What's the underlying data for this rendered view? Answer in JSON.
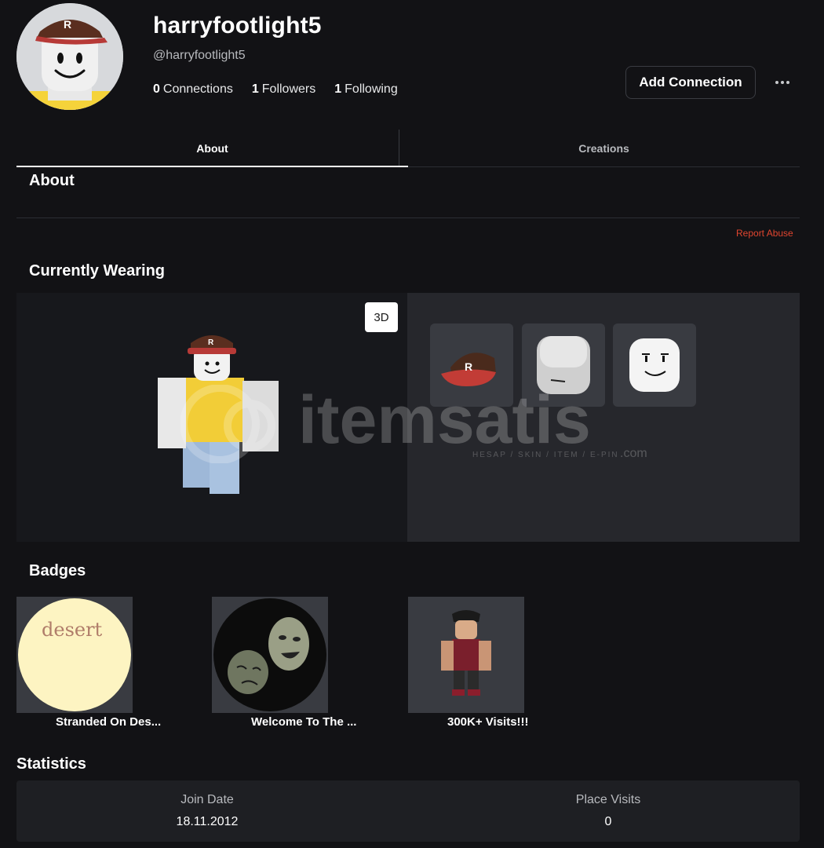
{
  "profile": {
    "display_name": "harryfootlight5",
    "handle": "@harryfootlight5",
    "connections_count": "0",
    "connections_label": "Connections",
    "followers_count": "1",
    "followers_label": "Followers",
    "following_count": "1",
    "following_label": "Following",
    "add_connection_label": "Add Connection",
    "more_icon": "more-horizontal-icon"
  },
  "tabs": [
    {
      "label": "About",
      "active": true
    },
    {
      "label": "Creations",
      "active": false
    }
  ],
  "about": {
    "title": "About",
    "report_label": "Report Abuse"
  },
  "wearing": {
    "title": "Currently Wearing",
    "view_3d_label": "3D",
    "items": [
      "cap-item",
      "head-item",
      "face-item"
    ]
  },
  "watermark": {
    "brand": "itemsatis",
    "tagline": "HESAP / SKIN / ITEM / E-PIN",
    "suffix": ".com"
  },
  "badges": {
    "title": "Badges",
    "items": [
      {
        "label": "Stranded On Des...",
        "image_text": "desert"
      },
      {
        "label": "Welcome To The ..."
      },
      {
        "label": "300K+ Visits!!!"
      }
    ]
  },
  "statistics": {
    "title": "Statistics",
    "join_label": "Join Date",
    "join_value": "18.11.2012",
    "visits_label": "Place Visits",
    "visits_value": "0"
  },
  "colors": {
    "background": "#121215",
    "report": "#e0452f",
    "shirt": "#f2cd37",
    "pants": "#a3bddc"
  }
}
